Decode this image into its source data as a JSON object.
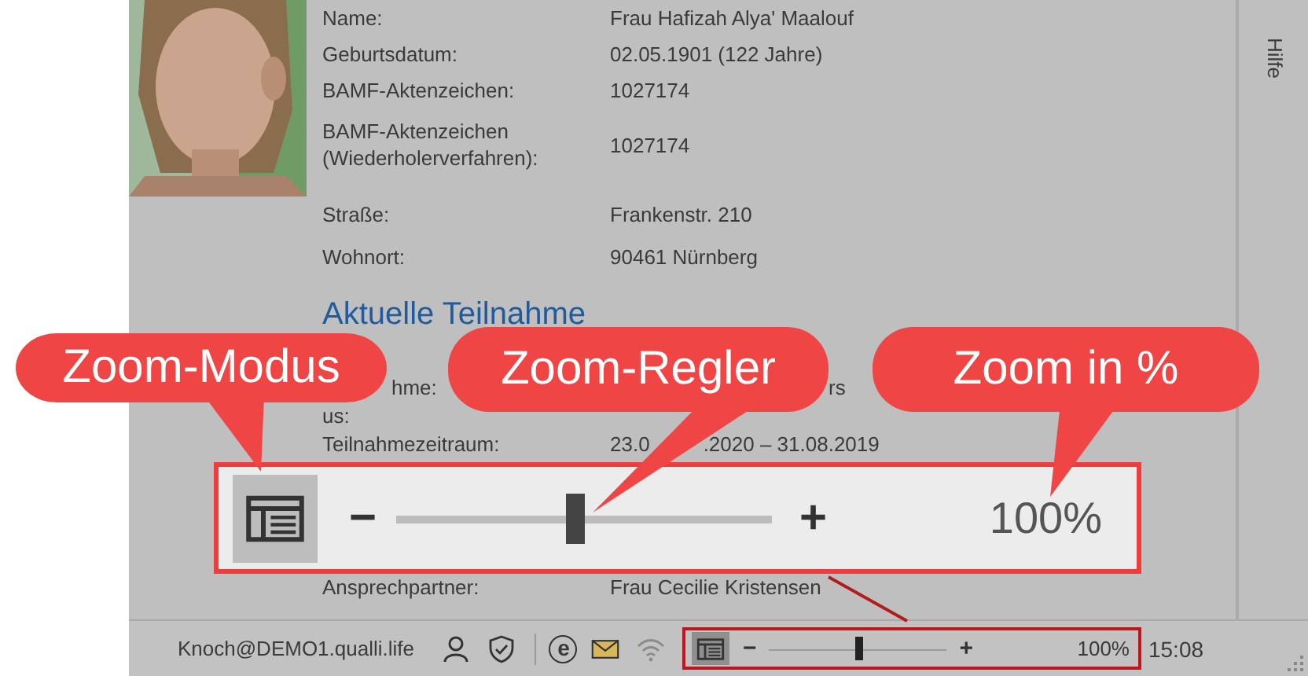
{
  "profile": {
    "fields": [
      {
        "label": "Name:",
        "value": "Frau Hafizah Alya' Maalouf"
      },
      {
        "label": "Geburtsdatum:",
        "value": "02.05.1901 (122 Jahre)"
      },
      {
        "label": "BAMF-Aktenzeichen:",
        "value": "1027174"
      },
      {
        "label": "BAMF-Aktenzeichen (Wiederholerverfahren):",
        "value": "1027174"
      },
      {
        "label": "Straße:",
        "value": "Frankenstr. 210"
      },
      {
        "label": "Wohnort:",
        "value": "90461 Nürnberg"
      }
    ]
  },
  "section": {
    "title": "Aktuelle Teilnahme",
    "fields": [
      {
        "kind": "covered",
        "label": "hme:",
        "value": "rs"
      },
      {
        "kind": "plain",
        "label": "us:"
      },
      {
        "kind": "split",
        "label": "Teilnahmezeitraum:",
        "value": "23.0",
        "value_continued": ".2020 – 31.08.2019"
      }
    ],
    "contact": {
      "label": "Ansprechpartner:",
      "value": "Frau Cecilie Kristensen"
    }
  },
  "side_tabs": [
    {
      "label": "Hilfe"
    }
  ],
  "zoom_magnified": {
    "mode_selected": true,
    "minus": "−",
    "plus": "+",
    "level": 0.48,
    "reading": "100%"
  },
  "callouts": [
    {
      "text": "Zoom-Modus"
    },
    {
      "text": "Zoom-Regler"
    },
    {
      "text": "Zoom in %"
    }
  ],
  "status_bar": {
    "user": "Knoch@DEMO1.qualli.life",
    "browser_icon": "e",
    "zoom": {
      "mode_selected": true,
      "minus": "−",
      "plus": "+",
      "level": 0.5,
      "reading": "100%"
    },
    "time": "15:08"
  }
}
